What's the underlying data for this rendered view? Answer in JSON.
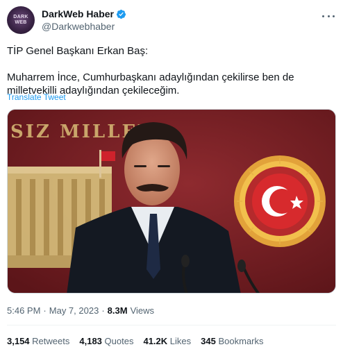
{
  "author": {
    "display_name": "DarkWeb Haber",
    "handle": "@Darkwebhaber",
    "avatar_text": "DARK WEB"
  },
  "tweet": {
    "line1": "TİP Genel Başkanı Erkan Baş:",
    "line2": "Muharrem İnce, Cumhurbaşkanı adaylığından çekilirse ben de",
    "line3": "milletvekilli adaylığından çekileceğim."
  },
  "translate_label": "Translate Tweet",
  "media": {
    "background_text": "SIZ MILLET"
  },
  "meta": {
    "time": "5:46 PM",
    "separator": "·",
    "date": "May 7, 2023",
    "views_count": "8.3M",
    "views_label": "Views"
  },
  "stats": {
    "retweets_count": "3,154",
    "retweets_label": "Retweets",
    "quotes_count": "4,183",
    "quotes_label": "Quotes",
    "likes_count": "41.2K",
    "likes_label": "Likes",
    "bookmarks_count": "345",
    "bookmarks_label": "Bookmarks"
  },
  "colors": {
    "accent": "#1d9bf0",
    "text": "#0f1419",
    "secondary": "#536471",
    "media_background": "#7a1f24"
  }
}
